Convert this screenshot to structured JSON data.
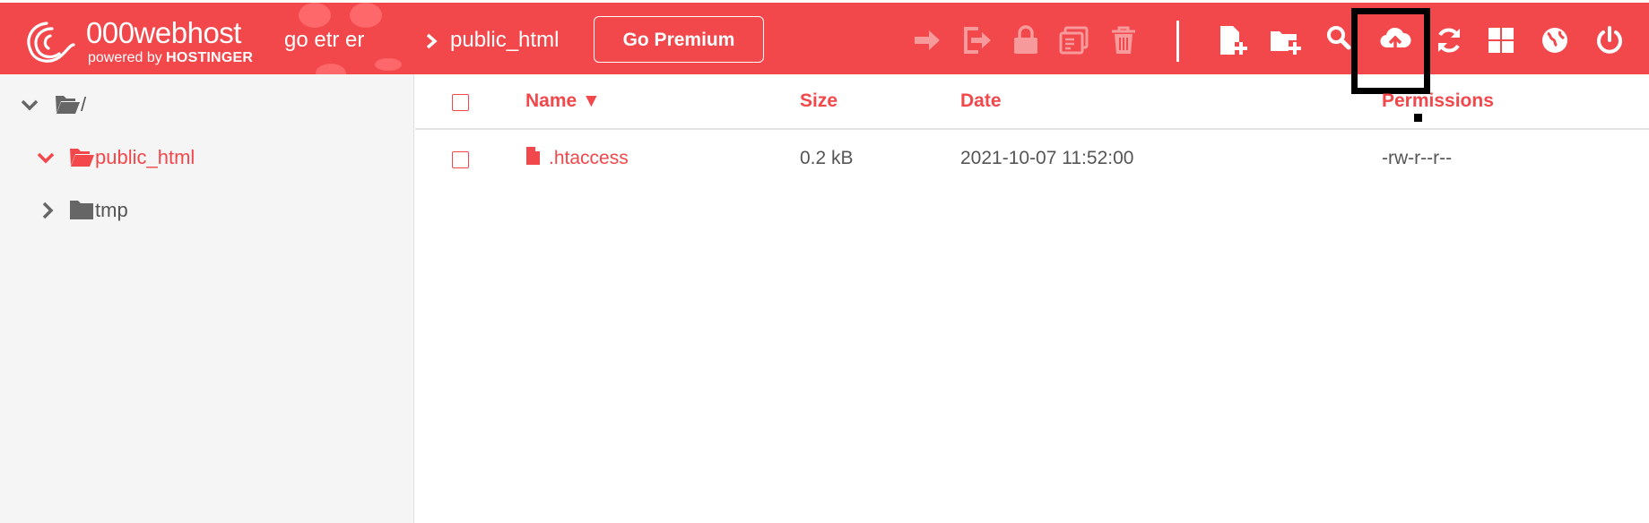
{
  "brand": {
    "name": "000webhost",
    "powered_by": "powered by",
    "company": "HOSTINGER"
  },
  "breadcrumb": {
    "site": "go etr er",
    "folder": "public_html"
  },
  "toolbar": {
    "premium_label": "Go Premium",
    "disabled_icons": [
      "move-icon",
      "rename-icon",
      "permissions-lock-icon",
      "archive-icon",
      "delete-icon"
    ],
    "active_icons": [
      "new-file-icon",
      "new-folder-icon",
      "search-icon",
      "upload-icon",
      "refresh-icon",
      "grid-view-icon",
      "website-icon",
      "logout-icon"
    ]
  },
  "sidebar": {
    "tree": [
      {
        "label": "/",
        "expanded": true,
        "level": 0,
        "selected": false
      },
      {
        "label": "public_html",
        "expanded": true,
        "level": 1,
        "selected": true
      },
      {
        "label": "tmp",
        "expanded": false,
        "level": 1,
        "selected": false
      }
    ]
  },
  "table": {
    "columns": {
      "name": "Name",
      "sort_indicator": "▼",
      "size": "Size",
      "date": "Date",
      "permissions": "Permissions"
    },
    "rows": [
      {
        "name": ".htaccess",
        "size": "0.2 kB",
        "date": "2021-10-07 11:52:00",
        "permissions": "-rw-r--r--"
      }
    ]
  },
  "colors": {
    "accent": "#f2474b",
    "disabled_icon": "#f79a9c",
    "sidebar_bg": "#f5f5f5",
    "text_muted": "#555555"
  }
}
